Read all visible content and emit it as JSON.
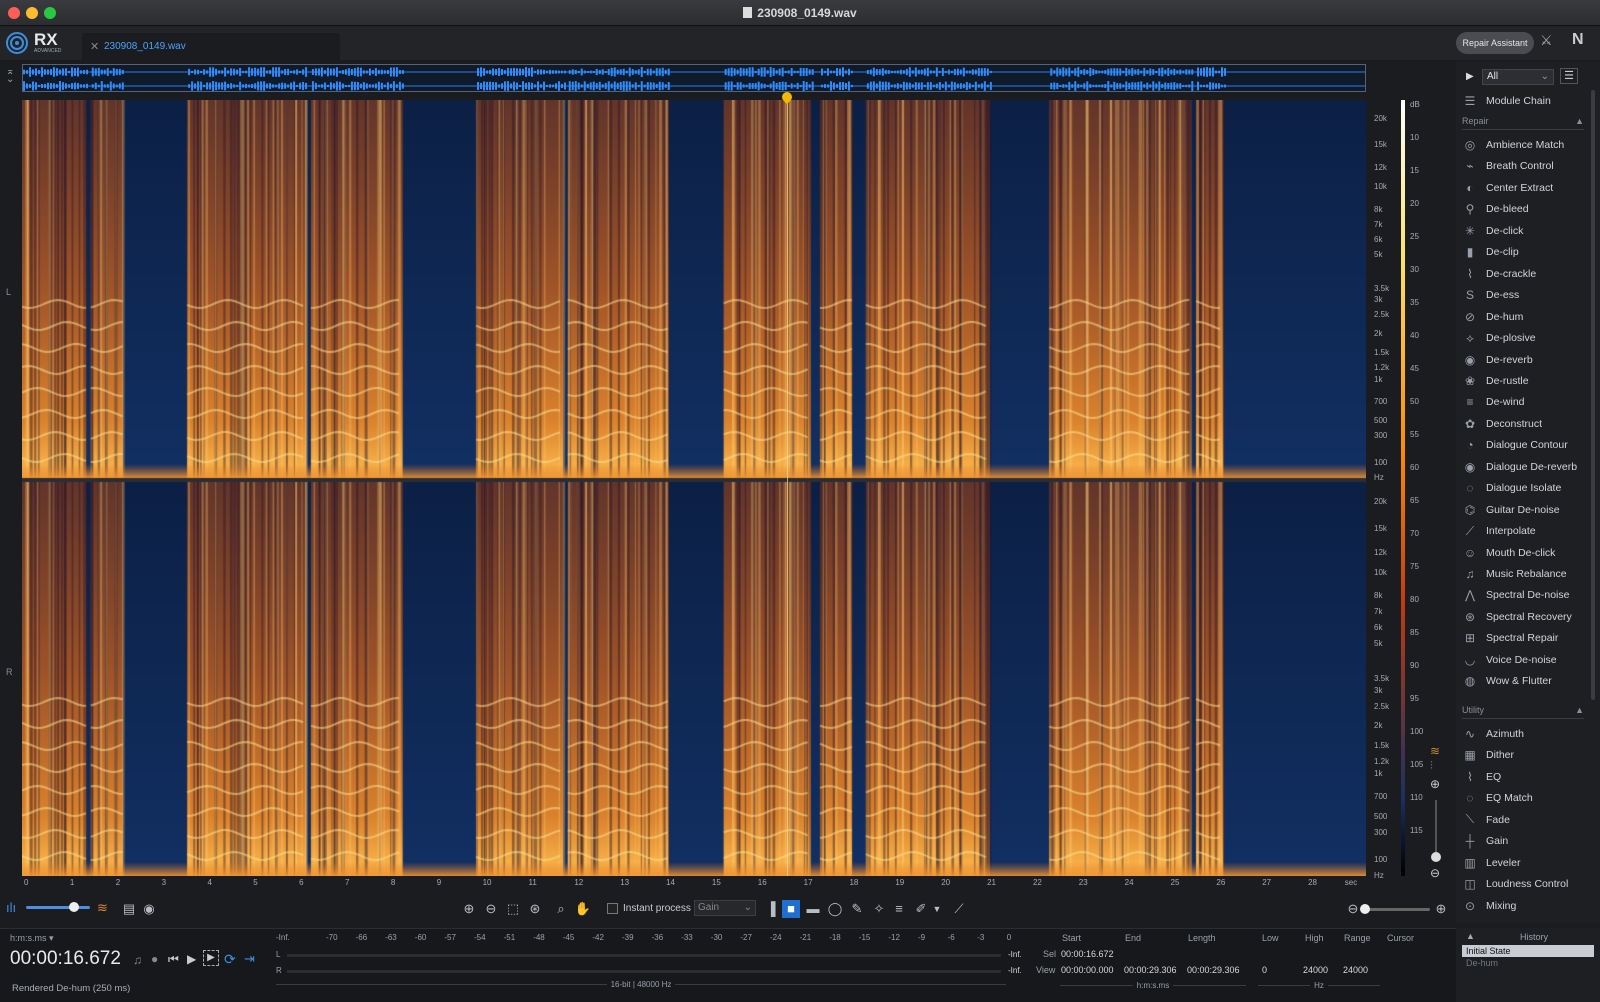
{
  "window": {
    "title": "230908_0149.wav"
  },
  "header": {
    "app_name": "RX",
    "app_edition": "ADVANCED",
    "tab_label": "230908_0149.wav",
    "repair_assistant_label": "Repair Assistant"
  },
  "spectrogram": {
    "channels": [
      "L",
      "R"
    ],
    "freq_labels": [
      "20k",
      "15k",
      "12k",
      "10k",
      "8k",
      "7k",
      "6k",
      "5k",
      "3.5k",
      "3k",
      "2.5k",
      "2k",
      "1.5k",
      "1.2k",
      "1k",
      "700",
      "500",
      "300",
      "100",
      "Hz"
    ],
    "db_labels": [
      "dB",
      "10",
      "15",
      "20",
      "25",
      "30",
      "35",
      "40",
      "45",
      "50",
      "55",
      "60",
      "65",
      "70",
      "75",
      "80",
      "85",
      "90",
      "95",
      "100",
      "105",
      "110",
      "115"
    ],
    "time_labels": [
      "0",
      "1",
      "2",
      "3",
      "4",
      "5",
      "6",
      "7",
      "8",
      "9",
      "10",
      "11",
      "12",
      "13",
      "14",
      "15",
      "16",
      "17",
      "18",
      "19",
      "20",
      "21",
      "22",
      "23",
      "24",
      "25",
      "26",
      "27",
      "28",
      "sec"
    ],
    "playhead_sec": 16.672,
    "duration_sec": 29.306
  },
  "panel": {
    "filter_value": "All",
    "module_chain_label": "Module Chain",
    "repair_section": "Repair",
    "repair_modules": [
      {
        "label": "Ambience Match",
        "icon": "ambience-match-icon"
      },
      {
        "label": "Breath Control",
        "icon": "breath-control-icon"
      },
      {
        "label": "Center Extract",
        "icon": "center-extract-icon"
      },
      {
        "label": "De-bleed",
        "icon": "de-bleed-icon"
      },
      {
        "label": "De-click",
        "icon": "de-click-icon"
      },
      {
        "label": "De-clip",
        "icon": "de-clip-icon"
      },
      {
        "label": "De-crackle",
        "icon": "de-crackle-icon"
      },
      {
        "label": "De-ess",
        "icon": "de-ess-icon"
      },
      {
        "label": "De-hum",
        "icon": "de-hum-icon"
      },
      {
        "label": "De-plosive",
        "icon": "de-plosive-icon"
      },
      {
        "label": "De-reverb",
        "icon": "de-reverb-icon"
      },
      {
        "label": "De-rustle",
        "icon": "de-rustle-icon"
      },
      {
        "label": "De-wind",
        "icon": "de-wind-icon"
      },
      {
        "label": "Deconstruct",
        "icon": "deconstruct-icon"
      },
      {
        "label": "Dialogue Contour",
        "icon": "dialogue-contour-icon"
      },
      {
        "label": "Dialogue De-reverb",
        "icon": "dialogue-de-reverb-icon"
      },
      {
        "label": "Dialogue Isolate",
        "icon": "dialogue-isolate-icon"
      },
      {
        "label": "Guitar De-noise",
        "icon": "guitar-de-noise-icon"
      },
      {
        "label": "Interpolate",
        "icon": "interpolate-icon"
      },
      {
        "label": "Mouth De-click",
        "icon": "mouth-de-click-icon"
      },
      {
        "label": "Music Rebalance",
        "icon": "music-rebalance-icon"
      },
      {
        "label": "Spectral De-noise",
        "icon": "spectral-de-noise-icon"
      },
      {
        "label": "Spectral Recovery",
        "icon": "spectral-recovery-icon"
      },
      {
        "label": "Spectral Repair",
        "icon": "spectral-repair-icon"
      },
      {
        "label": "Voice De-noise",
        "icon": "voice-de-noise-icon"
      },
      {
        "label": "Wow & Flutter",
        "icon": "wow-flutter-icon"
      }
    ],
    "utility_section": "Utility",
    "utility_modules": [
      {
        "label": "Azimuth",
        "icon": "azimuth-icon"
      },
      {
        "label": "Dither",
        "icon": "dither-icon"
      },
      {
        "label": "EQ",
        "icon": "eq-icon"
      },
      {
        "label": "EQ Match",
        "icon": "eq-match-icon"
      },
      {
        "label": "Fade",
        "icon": "fade-icon"
      },
      {
        "label": "Gain",
        "icon": "gain-icon"
      },
      {
        "label": "Leveler",
        "icon": "leveler-icon"
      },
      {
        "label": "Loudness Control",
        "icon": "loudness-control-icon"
      },
      {
        "label": "Mixing",
        "icon": "mixing-icon"
      }
    ]
  },
  "toolbar": {
    "instant_process_label": "Instant process",
    "instant_process_mode": "Gain",
    "opacity_fraction": 0.75
  },
  "transport": {
    "time_format": "h:m:s.ms",
    "timecode": "00:00:16.672",
    "status": "Rendered De-hum (250 ms)"
  },
  "meter": {
    "scale": [
      "-Inf.",
      "-70",
      "-66",
      "-63",
      "-60",
      "-57",
      "-54",
      "-51",
      "-48",
      "-45",
      "-42",
      "-39",
      "-36",
      "-33",
      "-30",
      "-27",
      "-24",
      "-21",
      "-18",
      "-15",
      "-12",
      "-9",
      "-6",
      "-3",
      "0"
    ],
    "left_value": "-Inf.",
    "right_value": "-Inf.",
    "format": "16-bit | 48000 Hz",
    "channels": [
      "L",
      "R"
    ]
  },
  "selection": {
    "headers": [
      "Start",
      "End",
      "Length",
      "Low",
      "High",
      "Range",
      "Cursor"
    ],
    "sel_label": "Sel",
    "view_label": "View",
    "sel_start": "00:00:16.672",
    "view_start": "00:00:00.000",
    "view_end": "00:00:29.306",
    "view_length": "00:00:29.306",
    "low": "0",
    "high": "24000",
    "range": "24000",
    "time_unit": "h:m:s.ms",
    "freq_unit": "Hz"
  },
  "history": {
    "title": "History",
    "items": [
      "Initial State",
      "De-hum"
    ]
  }
}
